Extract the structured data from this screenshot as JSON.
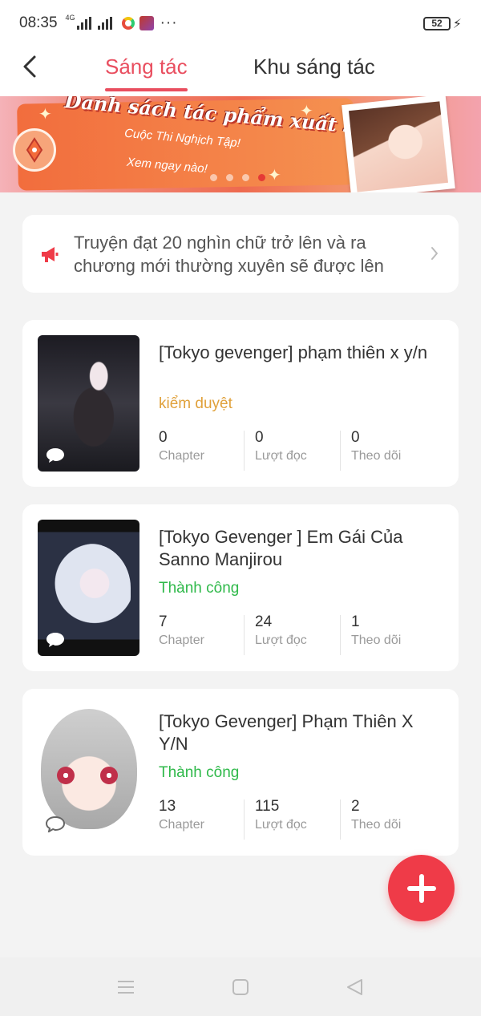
{
  "status_bar": {
    "time": "08:35",
    "network": "4G",
    "battery": "52"
  },
  "header": {
    "tabs": [
      {
        "label": "Sáng tác",
        "active": true
      },
      {
        "label": "Khu sáng tác",
        "active": false
      }
    ]
  },
  "banner": {
    "title": "Danh sách tác phẩm xuất sắc",
    "subtitle": "Cuộc Thi Nghịch Tập!",
    "cta": "Xem ngay nào!",
    "page_count": 4,
    "active_page": 4
  },
  "notice": {
    "text": "Truyện đạt 20 nghìn chữ trở lên và ra chương mới thường xuyên sẽ được lên"
  },
  "stories": [
    {
      "title": "[Tokyo gevenger] phạm thiên x y/n",
      "status": "kiểm duyệt",
      "status_type": "review",
      "stats": [
        {
          "value": "0",
          "label": "Chapter"
        },
        {
          "value": "0",
          "label": "Lượt đọc"
        },
        {
          "value": "0",
          "label": "Theo dõi"
        }
      ]
    },
    {
      "title": "[Tokyo Gevenger ] Em Gái Của Sanno Manjirou",
      "status": "Thành công",
      "status_type": "ok",
      "stats": [
        {
          "value": "7",
          "label": "Chapter"
        },
        {
          "value": "24",
          "label": "Lượt đọc"
        },
        {
          "value": "1",
          "label": "Theo dõi"
        }
      ]
    },
    {
      "title": "[Tokyo Gevenger] Phạm Thiên X Y/N",
      "status": "Thành công",
      "status_type": "ok",
      "stats": [
        {
          "value": "13",
          "label": "Chapter"
        },
        {
          "value": "115",
          "label": "Lượt đọc"
        },
        {
          "value": "2",
          "label": "Theo dõi"
        }
      ]
    }
  ],
  "colors": {
    "accent": "#e94e5f",
    "fab": "#ef3b48",
    "status_review": "#e0a13b",
    "status_ok": "#2fb94a"
  },
  "icons": {
    "back": "chevron-left-icon",
    "notice": "megaphone-icon",
    "notice_arrow": "chevron-right-icon",
    "fab": "plus-icon",
    "nav": [
      "menu-icon",
      "home-square-icon",
      "back-triangle-icon"
    ]
  }
}
